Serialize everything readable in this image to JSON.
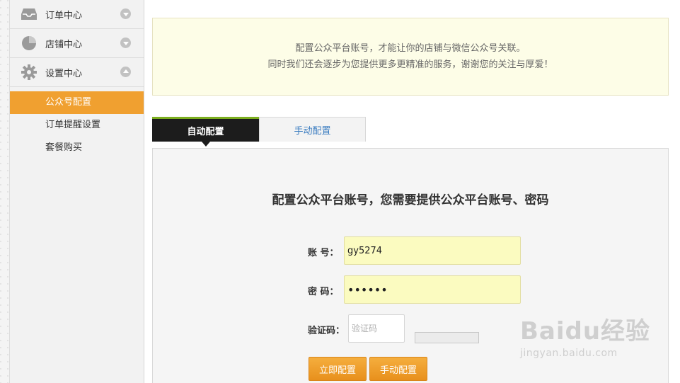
{
  "sidebar": {
    "groups": [
      {
        "label": "订单中心",
        "icon": "inbox-icon",
        "expanded": false
      },
      {
        "label": "店铺中心",
        "icon": "pie-chart-icon",
        "expanded": false
      },
      {
        "label": "设置中心",
        "icon": "gear-icon",
        "expanded": true
      }
    ],
    "sub_items": [
      {
        "label": "公众号配置",
        "active": true
      },
      {
        "label": "订单提醒设置",
        "active": false
      },
      {
        "label": "套餐购买",
        "active": false
      }
    ]
  },
  "notice": {
    "line1": "配置公众平台账号，才能让你的店铺与微信公众号关联。",
    "line2": "同时我们还会逐步为您提供更多更精准的服务，谢谢您的关注与厚爱！"
  },
  "tabs": [
    {
      "label": "自动配置",
      "active": true
    },
    {
      "label": "手动配置",
      "active": false
    }
  ],
  "form": {
    "title": "配置公众平台账号，您需要提供公众平台账号、密码",
    "account_label": "账  号：",
    "account_value": "gy5274",
    "password_label": "密  码：",
    "password_value": "••••••",
    "captcha_label": "验证码：",
    "captcha_placeholder": "验证码",
    "submit_label": "立即配置",
    "manual_label": "手动配置"
  },
  "watermark": {
    "brand": "Baidu经验",
    "url": "jingyan.baidu.com"
  },
  "colors": {
    "accent": "#f0a030",
    "tab_active_bg": "#1c1c1c",
    "tab_active_top": "#7cae1e",
    "link": "#3a7cc0",
    "notice_bg": "#fdfde7",
    "field_bg": "#fbfbc0"
  }
}
